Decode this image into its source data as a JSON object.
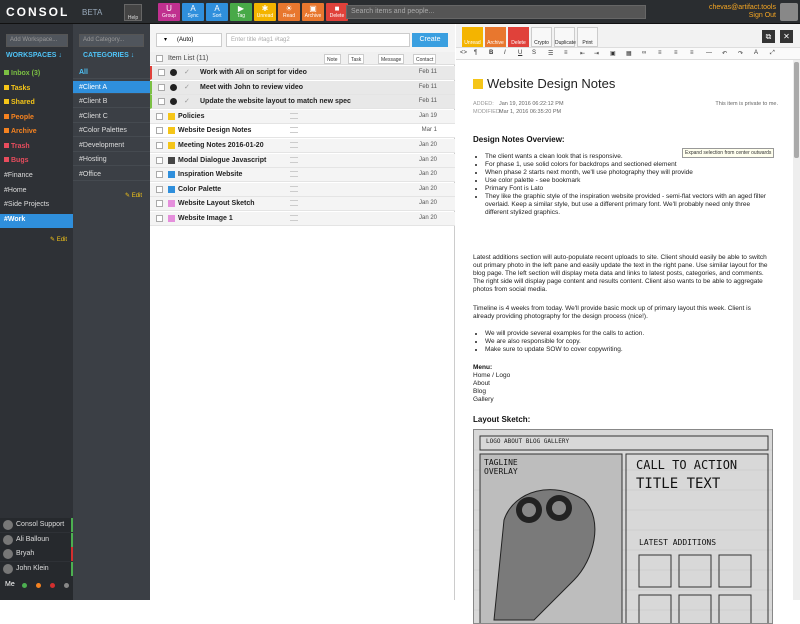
{
  "app": {
    "name": "CONSOL",
    "beta": "BETA",
    "help": "Help"
  },
  "toolbar": {
    "buttons": [
      {
        "label": "Group",
        "color": "#c0308f",
        "glyph": "U"
      },
      {
        "label": "Sync",
        "color": "#2f8fdc",
        "glyph": "A"
      },
      {
        "label": "Sort",
        "color": "#2f8fdc",
        "glyph": "A"
      },
      {
        "label": "Tag",
        "color": "#48a948",
        "glyph": "▶"
      },
      {
        "label": "Unread",
        "color": "#f4b400",
        "glyph": "✱"
      },
      {
        "label": "Read",
        "color": "#e8772e",
        "glyph": "☀"
      },
      {
        "label": "Archive",
        "color": "#e8772e",
        "glyph": "▣"
      },
      {
        "label": "Delete",
        "color": "#e0413a",
        "glyph": "■"
      }
    ]
  },
  "search": {
    "placeholder": "Search items and people..."
  },
  "user": {
    "email": "chevas@artifact.tools",
    "signout": "Sign Out"
  },
  "sidebar": {
    "add_workspace": "Add Workspace...",
    "workspaces_header": "WORKSPACES ↓",
    "workspaces": [
      {
        "label": "Inbox (3)",
        "color": "#7bc043"
      },
      {
        "label": "Tasks",
        "color": "#f5c518"
      },
      {
        "label": "Shared",
        "color": "#f5c518"
      },
      {
        "label": "People",
        "color": "#f58220"
      },
      {
        "label": "Archive",
        "color": "#f58220"
      },
      {
        "label": "Trash",
        "color": "#e84c5d"
      },
      {
        "label": "Bugs",
        "color": "#e84c5d"
      }
    ],
    "tags": [
      "#Finance",
      "#Home",
      "#Side Projects",
      "#Work"
    ],
    "edit": "Edit",
    "contacts": [
      {
        "name": "Consol Support",
        "status": "#4caf50"
      },
      {
        "name": "Ali Balloun",
        "status": "#4caf50"
      },
      {
        "name": "Bryah",
        "status": "#d32f2f"
      },
      {
        "name": "John Klein",
        "status": "#4caf50"
      }
    ],
    "me": "Me"
  },
  "categories": {
    "add": "Add Category...",
    "header": "CATEGORIES ↓",
    "items": [
      "All",
      "#Client A",
      "#Client B",
      "#Client C",
      "#Color Palettes",
      "#Development",
      "#Hosting",
      "#Office"
    ],
    "edit": "Edit"
  },
  "list": {
    "mode": "(Auto)",
    "title_placeholder": "Enter title #tag1 #tag2",
    "create": "Create",
    "count": "Item List (11)",
    "new_types": [
      "Note",
      "Task",
      "Message",
      "Contact"
    ],
    "items": [
      {
        "title": "Work with Ali on script for video",
        "date": "Feb 11",
        "type": "task",
        "accent": "#e0413a"
      },
      {
        "title": "Meet with John to review video",
        "date": "Feb 11",
        "type": "task",
        "accent": "#7bc043"
      },
      {
        "title": "Update the website layout to match new spec",
        "date": "Feb 11",
        "type": "task",
        "accent": "#7bc043"
      },
      {
        "title": "Policies",
        "date": "Jan 19",
        "type": "note",
        "accent": ""
      },
      {
        "title": "Website Design Notes",
        "date": "Mar 1",
        "type": "note",
        "accent": ""
      },
      {
        "title": "Meeting Notes 2016-01-20",
        "date": "Jan 20",
        "type": "note",
        "accent": ""
      },
      {
        "title": "Modal Dialogue Javascript",
        "date": "Jan 20",
        "type": "code",
        "accent": ""
      },
      {
        "title": "Inspiration Website",
        "date": "Jan 20",
        "type": "bookmark",
        "accent": ""
      },
      {
        "title": "Color Palette",
        "date": "Jan 20",
        "type": "bookmark",
        "accent": ""
      },
      {
        "title": "Website Layout Sketch",
        "date": "Jan 20",
        "type": "image",
        "accent": ""
      },
      {
        "title": "Website Image 1",
        "date": "Jan 20",
        "type": "image",
        "accent": ""
      }
    ]
  },
  "editor": {
    "buttons": [
      {
        "label": "Unread",
        "color": "#f4b400"
      },
      {
        "label": "Archive",
        "color": "#e8772e"
      },
      {
        "label": "Delete",
        "color": "#e0413a"
      },
      {
        "label": "Crypto",
        "color": "#f8f8f8"
      },
      {
        "label": "Duplicate",
        "color": "#f8f8f8"
      },
      {
        "label": "Print",
        "color": "#f8f8f8"
      }
    ],
    "title": "Website Design Notes",
    "added_label": "ADDED:",
    "added": "Jan 19, 2016 06:22:12 PM",
    "modified_label": "MODIFIED:",
    "modified": "Mar 1, 2016 06:35:20 PM",
    "privacy": "This item is private to me.",
    "tooltip": "Expand selection from center outwards",
    "h1": "Design Notes Overview:",
    "bullets1": [
      "The client wants a clean look that is responsive.",
      "For phase 1, use solid colors for backdrops and sectioned element",
      "When phase 2 starts next month, we'll use photography they will provide",
      "Use color palette - see bookmark",
      "Primary Font is Lato",
      "They like the graphic style of the inspiration website provided - semi-flat vectors with an aged filter overlaid. Keep a similar style, but use a different primary font. We'll probably need only three different stylized graphics."
    ],
    "para1": "Latest additions section will auto-populate recent uploads to site. Client should easily be able to switch out primary photo in the left pane and easily update the text in the right pane. Use similar layout for the blog page. The left section will display meta data and links to latest posts, categories, and comments. The right side will display page content and results content. Client also wants to be able to aggregate photos from social media.",
    "para2": "Timeline is 4 weeks from today. We'll provide basic mock up of primary layout this week. Client is already providing photography for the design process (nice!).",
    "bullets2": [
      "We will provide several examples for the calls to action.",
      "We are also responsible for copy.",
      "Make sure to update SOW to cover copywriting."
    ],
    "menu_h": "Menu:",
    "menu": [
      "Home / Logo",
      "About",
      "Blog",
      "Gallery"
    ],
    "h2": "Layout Sketch:",
    "sketch": {
      "nav": "LOGO    ABOUT    BLOG    GALLERY",
      "tagline": "TAGLINE OVERLAY",
      "cta1": "CALL TO ACTION",
      "cta2": "TITLE TEXT",
      "latest": "LATEST ADDITIONS"
    }
  }
}
